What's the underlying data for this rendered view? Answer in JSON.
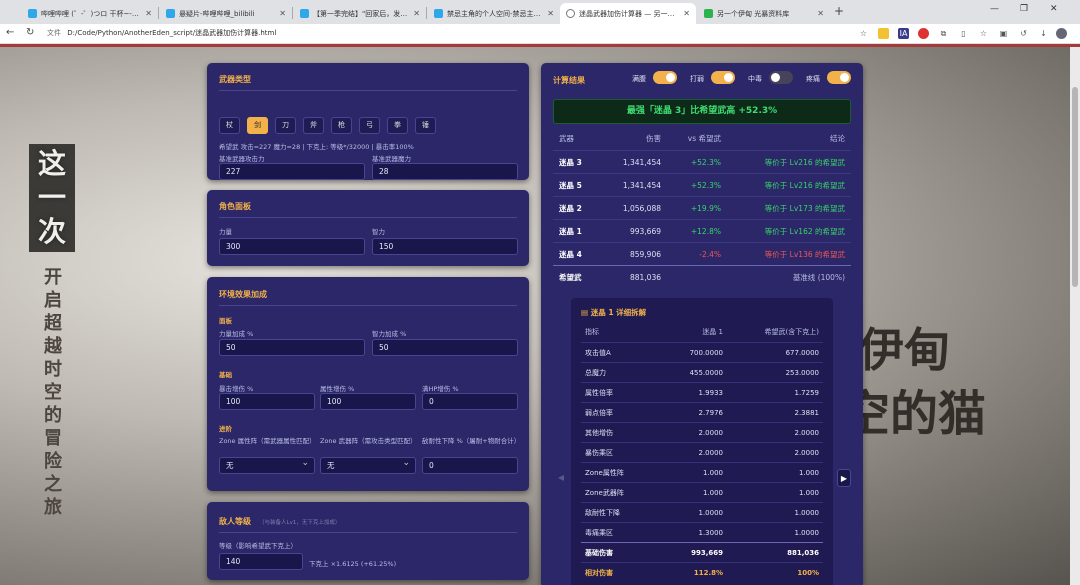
{
  "browser": {
    "tabs": [
      {
        "title": "哔哩哔哩 (゜-゜)つロ 干杯~-bilibili",
        "color": "#2ea8e8"
      },
      {
        "title": "悬疑片-哔哩哔哩_bilibili",
        "color": "#2ea8e8"
      },
      {
        "title": "【第一季完结】\"回家后，发现老婆",
        "color": "#2ea8e8"
      },
      {
        "title": "禁忌主角的个人空间-禁忌主角个人",
        "color": "#2ea8e8"
      },
      {
        "title": "迷晶武器加伤计算器 — 另一个伊甸",
        "color": "#777777"
      },
      {
        "title": "另一个伊甸 光暴资料库",
        "color": "#2bb24c"
      }
    ],
    "url_label": "文件",
    "url": "D:/Code/Python/AnotherEden_script/迷晶武器加伤计算器.html"
  },
  "background": {
    "vertical_title": "这一次",
    "vertical_sub": "开启超越时空的冒险之旅",
    "right_text_1": "伊甸",
    "right_text_2": "空的猫"
  },
  "weapon": {
    "title": "武器类型",
    "types": [
      "杖",
      "剑",
      "刀",
      "斧",
      "枪",
      "弓",
      "拳",
      "锤"
    ],
    "selected": "剑",
    "info": "希望武 攻击=227 魔力=28 | 下克上: 等级*/32000 | 暴击率100%",
    "atk_label": "基准武器攻击力",
    "atk_value": "227",
    "mag_label": "基准武器魔力",
    "mag_value": "28"
  },
  "character": {
    "title": "角色面板",
    "str_label": "力量",
    "str_value": "300",
    "int_label": "智力",
    "int_value": "150"
  },
  "env": {
    "title": "环境效果加成",
    "panel_sub": "面板",
    "str_pct_label": "力量加成 %",
    "str_pct_value": "50",
    "int_pct_label": "智力加成 %",
    "int_pct_value": "50",
    "base_sub": "基础",
    "crit_label": "暴击增伤 %",
    "crit_value": "100",
    "attr_label": "属性增伤 %",
    "attr_value": "100",
    "hp_label": "满HP增伤 %",
    "hp_value": "0",
    "adv_sub": "进阶",
    "zone_attr_label": "Zone 属性阵（需武器属性匹配）",
    "zone_attr_value": "无",
    "zone_weapon_label": "Zone 武器阵（需攻击类型匹配）",
    "zone_weapon_value": "无",
    "def_down_label": "敌耐性下降 %（屠耐+物耐合计）",
    "def_down_value": "0"
  },
  "enemy": {
    "title": "敌人等级",
    "note": "（与装备人Lv1，无下克上加成）",
    "level_label": "等级（影响希望武下克上）",
    "level_value": "140",
    "bonus_text": "下克上 ×1.6125 (+61.25%)"
  },
  "result": {
    "title": "计算结果",
    "toggles": [
      {
        "label": "满腹",
        "on": true
      },
      {
        "label": "打弱",
        "on": true
      },
      {
        "label": "中毒",
        "on": false
      },
      {
        "label": "疼痛",
        "on": true
      }
    ],
    "banner": "最强「迷晶 3」比希望武高 +52.3%",
    "headers": [
      "武器",
      "伤害",
      "vs 希望武",
      "结论"
    ],
    "rows": [
      {
        "name": "迷晶 3",
        "damage": "1,341,454",
        "vs": "+52.3%",
        "conclusion": "等价于 Lv216 的希望武",
        "tone": "pos"
      },
      {
        "name": "迷晶 5",
        "damage": "1,341,454",
        "vs": "+52.3%",
        "conclusion": "等价于 Lv216 的希望武",
        "tone": "pos"
      },
      {
        "name": "迷晶 2",
        "damage": "1,056,088",
        "vs": "+19.9%",
        "conclusion": "等价于 Lv173 的希望武",
        "tone": "pos"
      },
      {
        "name": "迷晶 1",
        "damage": "993,669",
        "vs": "+12.8%",
        "conclusion": "等价于 Lv162 的希望武",
        "tone": "pos"
      },
      {
        "name": "迷晶 4",
        "damage": "859,906",
        "vs": "-2.4%",
        "conclusion": "等价于 Lv136 的希望武",
        "tone": "neg"
      },
      {
        "name": "希望武",
        "damage": "881,036",
        "vs": "",
        "conclusion": "基准线 (100%)",
        "tone": "base"
      }
    ]
  },
  "detail": {
    "title": "迷晶 1 详细拆解",
    "headers": [
      "指标",
      "迷晶 1",
      "希望武(含下克上)"
    ],
    "rows": [
      [
        "攻击值A",
        "700.0000",
        "677.0000"
      ],
      [
        "总魔力",
        "455.0000",
        "253.0000"
      ],
      [
        "属性倍率",
        "1.9933",
        "1.7259"
      ],
      [
        "弱点倍率",
        "2.7976",
        "2.3881"
      ],
      [
        "其他增伤",
        "2.0000",
        "2.0000"
      ],
      [
        "暴伤乘区",
        "2.0000",
        "2.0000"
      ],
      [
        "Zone属性阵",
        "1.000",
        "1.000"
      ],
      [
        "Zone武器阵",
        "1.000",
        "1.000"
      ],
      [
        "敌耐性下降",
        "1.0000",
        "1.0000"
      ],
      [
        "毒痛乘区",
        "1.3000",
        "1.0000"
      ]
    ],
    "total": [
      "基础伤害",
      "993,669",
      "881,036"
    ],
    "relative": [
      "相对伤害",
      "112.8%",
      "100%"
    ],
    "prev_icon": "arrow-left-icon",
    "next_icon": "arrow-right-icon"
  },
  "colors": {
    "panel": "#2b2768",
    "accent": "#f2b14a",
    "positive": "#38d46c",
    "negative": "#ef5757"
  }
}
